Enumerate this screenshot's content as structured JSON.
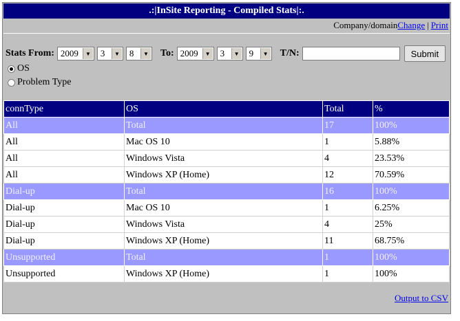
{
  "title": ".:|InSite Reporting - Compiled Stats|:.",
  "toplinks": {
    "prefix": "Company/domain",
    "change": "Change",
    "separator": "|",
    "print": "Print"
  },
  "form": {
    "stats_from_label": "Stats From:",
    "to_label": "To:",
    "tn_label": "T/N:",
    "from": {
      "year": "2009",
      "month": "3",
      "day": "8"
    },
    "to": {
      "year": "2009",
      "month": "3",
      "day": "9"
    },
    "tn_value": "",
    "submit_label": "Submit",
    "radio_os": "OS",
    "radio_problem": "Problem Type"
  },
  "table": {
    "headers": [
      "connType",
      "OS",
      "Total",
      "%"
    ],
    "rows": [
      {
        "type": "total",
        "cells": [
          "All",
          "Total",
          "17",
          "100%"
        ]
      },
      {
        "type": "data",
        "cells": [
          "All",
          "Mac OS 10",
          "1",
          "5.88%"
        ]
      },
      {
        "type": "data",
        "cells": [
          "All",
          "Windows Vista",
          "4",
          "23.53%"
        ]
      },
      {
        "type": "data",
        "cells": [
          "All",
          "Windows XP (Home)",
          "12",
          "70.59%"
        ]
      },
      {
        "type": "total",
        "cells": [
          "Dial-up",
          "Total",
          "16",
          "100%"
        ]
      },
      {
        "type": "data",
        "cells": [
          "Dial-up",
          "Mac OS 10",
          "1",
          "6.25%"
        ]
      },
      {
        "type": "data",
        "cells": [
          "Dial-up",
          "Windows Vista",
          "4",
          "25%"
        ]
      },
      {
        "type": "data",
        "cells": [
          "Dial-up",
          "Windows XP (Home)",
          "11",
          "68.75%"
        ]
      },
      {
        "type": "total",
        "cells": [
          "Unsupported",
          "Total",
          "1",
          "100%"
        ]
      },
      {
        "type": "data",
        "cells": [
          "Unsupported",
          "Windows XP (Home)",
          "1",
          "100%"
        ]
      }
    ]
  },
  "footer": {
    "csv_link": "Output to CSV"
  },
  "colors": {
    "header_bg": "#000080",
    "total_row_bg": "#9999ff",
    "panel_bg": "#c0c0c0",
    "link": "#0000ee"
  }
}
